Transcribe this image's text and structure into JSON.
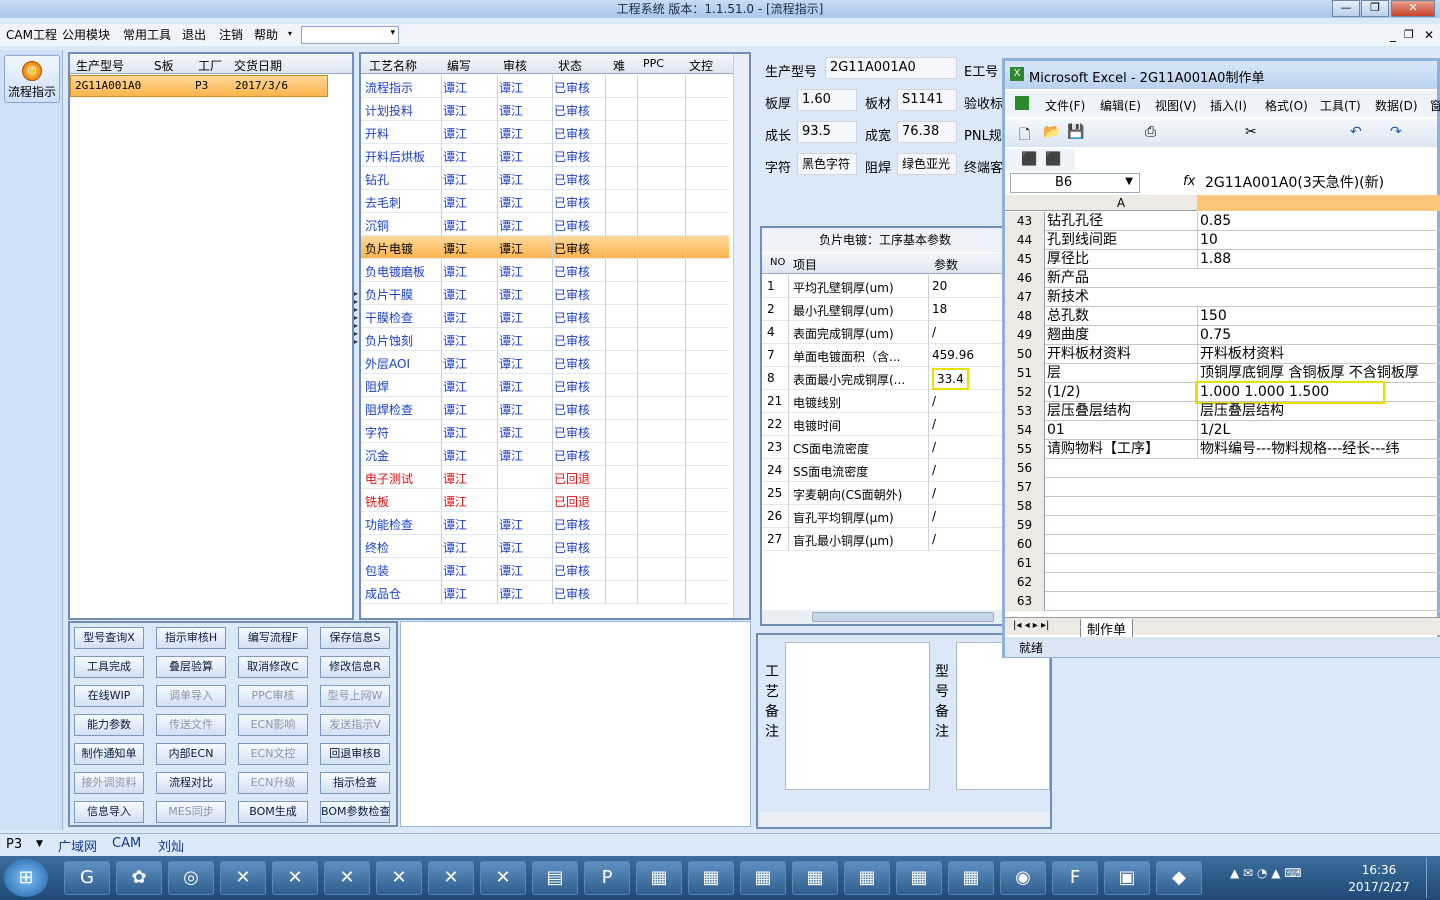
{
  "window": {
    "title": "工程系统   版本：1.1.51.0 - [流程指示]",
    "controls": [
      "—",
      "❐",
      "✕"
    ]
  },
  "menu": {
    "items": [
      "CAM工程",
      "公用模块",
      "常用工具",
      "退出",
      "注销",
      "帮助"
    ],
    "right_controls": [
      "_",
      "❐",
      "✕"
    ]
  },
  "left_strip": {
    "flow_button": "流程指示"
  },
  "model_table": {
    "headers": [
      "生产型号",
      "S板",
      "工厂",
      "交货日期"
    ],
    "rows": [
      [
        "2G11A001A0",
        "",
        "P3",
        "2017/3/6"
      ]
    ]
  },
  "process_table": {
    "headers": [
      "工艺名称",
      "编写",
      "审核",
      "状态",
      "难",
      "PPC",
      "文控"
    ],
    "rows": [
      {
        "name": "流程指示",
        "writer": "谭江",
        "reviewer": "谭江",
        "status": "已审核",
        "color": "blue"
      },
      {
        "name": "计划投料",
        "writer": "谭江",
        "reviewer": "谭江",
        "status": "已审核",
        "color": "blue"
      },
      {
        "name": "开料",
        "writer": "谭江",
        "reviewer": "谭江",
        "status": "已审核",
        "color": "blue"
      },
      {
        "name": "开料后烘板",
        "writer": "谭江",
        "reviewer": "谭江",
        "status": "已审核",
        "color": "blue"
      },
      {
        "name": "钻孔",
        "writer": "谭江",
        "reviewer": "谭江",
        "status": "已审核",
        "color": "blue"
      },
      {
        "name": "去毛刺",
        "writer": "谭江",
        "reviewer": "谭江",
        "status": "已审核",
        "color": "blue"
      },
      {
        "name": "沉铜",
        "writer": "谭江",
        "reviewer": "谭江",
        "status": "已审核",
        "color": "blue"
      },
      {
        "name": "负片电镀",
        "writer": "谭江",
        "reviewer": "谭江",
        "status": "已审核",
        "color": "selected"
      },
      {
        "name": "负电镀磨板",
        "writer": "谭江",
        "reviewer": "谭江",
        "status": "已审核",
        "color": "blue"
      },
      {
        "name": "负片干膜",
        "writer": "谭江",
        "reviewer": "谭江",
        "status": "已审核",
        "color": "blue"
      },
      {
        "name": "干膜检查",
        "writer": "谭江",
        "reviewer": "谭江",
        "status": "已审核",
        "color": "blue"
      },
      {
        "name": "负片蚀刻",
        "writer": "谭江",
        "reviewer": "谭江",
        "status": "已审核",
        "color": "blue"
      },
      {
        "name": "外层AOI",
        "writer": "谭江",
        "reviewer": "谭江",
        "status": "已审核",
        "color": "blue"
      },
      {
        "name": "阻焊",
        "writer": "谭江",
        "reviewer": "谭江",
        "status": "已审核",
        "color": "blue"
      },
      {
        "name": "阻焊检查",
        "writer": "谭江",
        "reviewer": "谭江",
        "status": "已审核",
        "color": "blue"
      },
      {
        "name": "字符",
        "writer": "谭江",
        "reviewer": "谭江",
        "status": "已审核",
        "color": "blue"
      },
      {
        "name": "沉金",
        "writer": "谭江",
        "reviewer": "谭江",
        "status": "已审核",
        "color": "blue"
      },
      {
        "name": "电子测试",
        "writer": "谭江",
        "reviewer": "",
        "status": "已回退",
        "color": "red"
      },
      {
        "name": "铣板",
        "writer": "谭江",
        "reviewer": "",
        "status": "已回退",
        "color": "red"
      },
      {
        "name": "功能检查",
        "writer": "谭江",
        "reviewer": "谭江",
        "status": "已审核",
        "color": "blue"
      },
      {
        "name": "终检",
        "writer": "谭江",
        "reviewer": "谭江",
        "status": "已审核",
        "color": "blue"
      },
      {
        "name": "包装",
        "writer": "谭江",
        "reviewer": "谭江",
        "status": "已审核",
        "color": "blue"
      },
      {
        "name": "成品仓",
        "writer": "谭江",
        "reviewer": "谭江",
        "status": "已审核",
        "color": "blue"
      }
    ]
  },
  "action_buttons": [
    {
      "label": "型号查询X",
      "enabled": true
    },
    {
      "label": "指示审核H",
      "enabled": true
    },
    {
      "label": "编写流程F",
      "enabled": true
    },
    {
      "label": "保存信息S",
      "enabled": true
    },
    {
      "label": "工具完成",
      "enabled": true
    },
    {
      "label": "叠层验算",
      "enabled": true
    },
    {
      "label": "取消修改C",
      "enabled": true
    },
    {
      "label": "修改信息R",
      "enabled": true
    },
    {
      "label": "在线WIP",
      "enabled": true
    },
    {
      "label": "调单导入",
      "enabled": false
    },
    {
      "label": "PPC审核",
      "enabled": false
    },
    {
      "label": "型号上网W",
      "enabled": false
    },
    {
      "label": "能力参数",
      "enabled": true
    },
    {
      "label": "传送文件",
      "enabled": false
    },
    {
      "label": "ECN影响",
      "enabled": false
    },
    {
      "label": "发送指示V",
      "enabled": false
    },
    {
      "label": "制作通知单",
      "enabled": true
    },
    {
      "label": "内部ECN",
      "enabled": true
    },
    {
      "label": "ECN文控",
      "enabled": false
    },
    {
      "label": "回退审核B",
      "enabled": true
    },
    {
      "label": "接外调资料",
      "enabled": false
    },
    {
      "label": "流程对比",
      "enabled": true
    },
    {
      "label": "ECN升级",
      "enabled": false
    },
    {
      "label": "指示检查",
      "enabled": true
    },
    {
      "label": "信息导入",
      "enabled": true
    },
    {
      "label": "MES同步",
      "enabled": false
    },
    {
      "label": "BOM生成",
      "enabled": true
    },
    {
      "label": "BOM参数检查",
      "enabled": true
    }
  ],
  "info": {
    "model_label": "生产型号",
    "model_value": "2G11A001A0",
    "e_label": "E工号",
    "thickness_label": "板厚",
    "thickness_value": "1.60",
    "material_label": "板材",
    "material_value": "S1141",
    "accept_label": "验收标",
    "length_label": "成长",
    "length_value": "93.5",
    "width_label": "成宽",
    "width_value": "76.38",
    "pnl_label": "PNL规",
    "char_label": "字符",
    "char_value": "黑色字符",
    "mask_label": "阻焊",
    "mask_value": "绿色亚光",
    "end_label": "终端客"
  },
  "params": {
    "title": "负片电镀：工序基本参数",
    "headers": [
      "NO",
      "项目",
      "参数"
    ],
    "rows": [
      {
        "no": "1",
        "item": "平均孔壁铜厚(um)",
        "value": "20"
      },
      {
        "no": "2",
        "item": "最小孔壁铜厚(um)",
        "value": "18"
      },
      {
        "no": "4",
        "item": "表面完成铜厚(um)",
        "value": "/"
      },
      {
        "no": "7",
        "item": "单面电镀面积（含...",
        "value": "459.96"
      },
      {
        "no": "8",
        "item": "表面最小完成铜厚(...",
        "value": "33.4",
        "highlight": true
      },
      {
        "no": "21",
        "item": "电镀线别",
        "value": "/"
      },
      {
        "no": "22",
        "item": "电镀时间",
        "value": "/"
      },
      {
        "no": "23",
        "item": "CS面电流密度",
        "value": "/"
      },
      {
        "no": "24",
        "item": "SS面电流密度",
        "value": "/"
      },
      {
        "no": "25",
        "item": "字麦朝向(CS面朝外)",
        "value": "/"
      },
      {
        "no": "26",
        "item": "盲孔平均铜厚(μm)",
        "value": "/"
      },
      {
        "no": "27",
        "item": "盲孔最小铜厚(μm)",
        "value": "/"
      }
    ]
  },
  "notes": {
    "process_note_label": "工艺备注",
    "model_note_label": "型号备注"
  },
  "excel": {
    "title": "Microsoft Excel - 2G11A001A0制作单",
    "menu": [
      "文件(F)",
      "编辑(E)",
      "视图(V)",
      "插入(I)",
      "格式(O)",
      "工具(T)",
      "数据(D)",
      "窗"
    ],
    "cell_ref": "B6",
    "fx": "fx",
    "formula": "2G11A001A0(3天急件)(新)",
    "col_a": "A",
    "rows": [
      {
        "n": "43",
        "a": "钻孔孔径",
        "b": "0.85"
      },
      {
        "n": "44",
        "a": "孔到线间距",
        "b": "10"
      },
      {
        "n": "45",
        "a": "厚径比",
        "b": "1.88"
      },
      {
        "n": "46",
        "a": "新产品",
        "b": ""
      },
      {
        "n": "47",
        "a": "新技术",
        "b": ""
      },
      {
        "n": "48",
        "a": "总孔数",
        "b": "150"
      },
      {
        "n": "49",
        "a": "翘曲度",
        "b": "0.75"
      },
      {
        "n": "50",
        "a": "开料板材资料",
        "b": "开料板材资料"
      },
      {
        "n": "51",
        "a": "层",
        "b": "顶铜厚底铜厚 含铜板厚 不含铜板厚"
      },
      {
        "n": "52",
        "a": "(1/2)",
        "b": "1.000  1.000   1.500",
        "highlight": true
      },
      {
        "n": "53",
        "a": "层压叠层结构",
        "b": "层压叠层结构"
      },
      {
        "n": "54",
        "a": "01",
        "b": "1/2L"
      },
      {
        "n": "55",
        "a": "请购物料【工序】",
        "b": "物料编号---物料规格---经长---纬"
      },
      {
        "n": "56",
        "a": "",
        "b": ""
      },
      {
        "n": "57",
        "a": "",
        "b": ""
      },
      {
        "n": "58",
        "a": "",
        "b": ""
      },
      {
        "n": "59",
        "a": "",
        "b": ""
      },
      {
        "n": "60",
        "a": "",
        "b": ""
      },
      {
        "n": "61",
        "a": "",
        "b": ""
      },
      {
        "n": "62",
        "a": "",
        "b": ""
      },
      {
        "n": "63",
        "a": "",
        "b": ""
      }
    ],
    "sheet_tab": "制作单",
    "status": "就绪"
  },
  "statusbar": {
    "factory": "P3",
    "items": [
      "广域网",
      "CAM",
      "刘灿"
    ]
  },
  "taskbar": {
    "time": "16:36",
    "date": "2017/2/27"
  }
}
